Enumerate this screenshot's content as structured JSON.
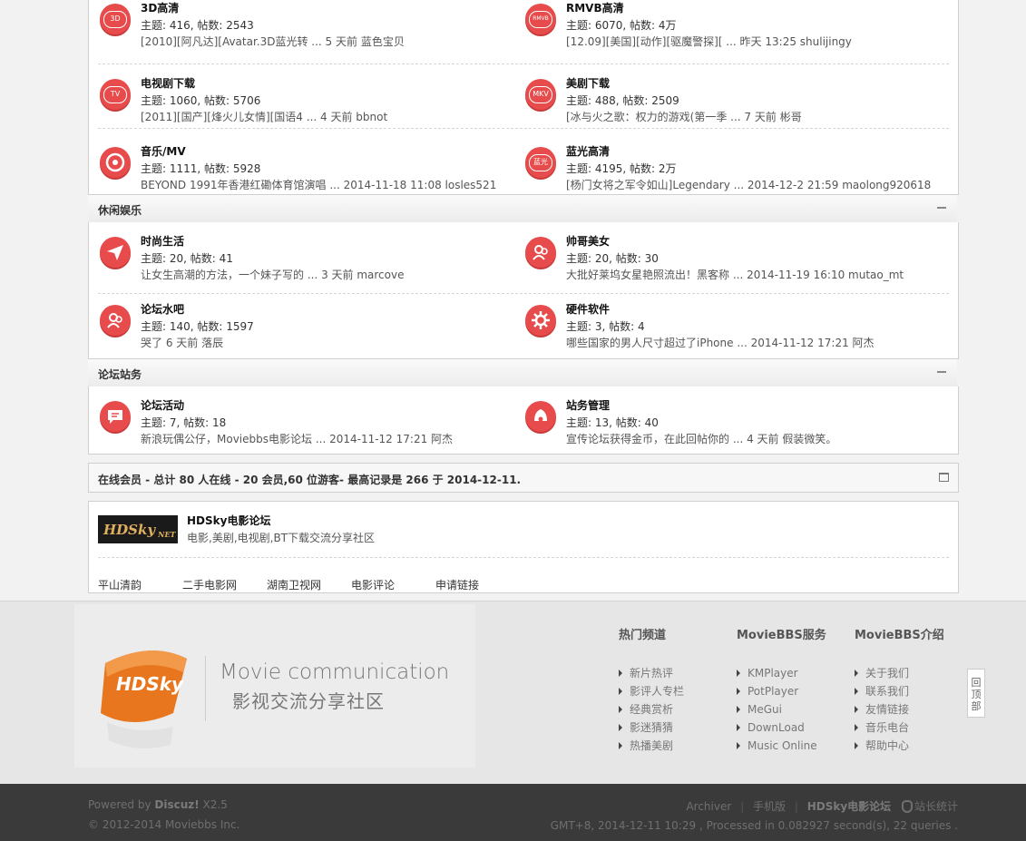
{
  "top_forums": [
    [
      {
        "name": "3D高清",
        "stats": "主题: 416, 帖数: 2543",
        "last": "[2010][阿凡达][Avatar.3D蓝光转 ... 5 天前 蓝色宝贝",
        "icon": "3d-icon",
        "badge": "3D"
      },
      {
        "name": "RMVB高清",
        "stats": "主题: 6070, 帖数: 4万",
        "last": "[12.09][美国][动作][驱魔警探][ ... 昨天 13:25 shulijingy",
        "icon": "rmvb-icon",
        "badge": "RMVB"
      }
    ],
    [
      {
        "name": "电视剧下载",
        "stats": "主题: 1060, 帖数: 5706",
        "last": "[2011][国产][烽火儿女情][国语4 ... 4 天前 bbnot",
        "icon": "tv-icon",
        "badge": "TV"
      },
      {
        "name": "美剧下载",
        "stats": "主题: 488, 帖数: 2509",
        "last": "[冰与火之歌：权力的游戏(第一季 ... 7 天前 彬哥",
        "icon": "mkv-icon",
        "badge": "MKV"
      }
    ],
    [
      {
        "name": "音乐/MV",
        "stats": "主题: 1111, 帖数: 5928",
        "last": "BEYOND 1991年香港红磡体育馆演唱 ... 2014-11-18 11:08 losles521",
        "icon": "music-disc-icon",
        "badge": ""
      },
      {
        "name": "蓝光高清",
        "stats": "主题: 4195, 帖数: 2万",
        "last": "[杨门女将之军令如山]Legendary ... 2014-12-2 21:59 maolong920618",
        "icon": "bluray-icon",
        "badge": "蓝光"
      }
    ]
  ],
  "cat_leisure": {
    "title": "休闲娱乐"
  },
  "leisure_forums": [
    [
      {
        "name": "时尚生活",
        "stats": "主题: 20, 帖数: 41",
        "last": "让女生高潮的方法，一个妹子写的 ... 3 天前 marcove",
        "icon": "paper-plane-icon",
        "badge": ""
      },
      {
        "name": "帅哥美女",
        "stats": "主题: 20, 帖数: 30",
        "last": "大批好莱坞女星艳照流出！黑客称 ... 2014-11-19 16:10 mutao_mt",
        "icon": "users-icon",
        "badge": ""
      }
    ],
    [
      {
        "name": "论坛水吧",
        "stats": "主题: 140, 帖数: 1597",
        "last": "哭了 6 天前 落辰",
        "icon": "users-icon",
        "badge": ""
      },
      {
        "name": "硬件软件",
        "stats": "主题: 3, 帖数: 4",
        "last": "哪些国家的男人尺寸超过了iPhone ... 2014-11-12 17:21 阿杰",
        "icon": "gear-icon",
        "badge": ""
      }
    ]
  ],
  "cat_admin": {
    "title": "论坛站务"
  },
  "admin_forums": [
    [
      {
        "name": "论坛活动",
        "stats": "主题: 7, 帖数: 18",
        "last": "新浪玩偶公仔，Moviebbs电影论坛 ... 2014-11-12 17:21 阿杰",
        "icon": "chat-icon",
        "badge": ""
      },
      {
        "name": "站务管理",
        "stats": "主题: 13, 帖数: 40",
        "last": "宣传论坛获得金币，在此回帖你的 ... 4 天前 假装微笑。",
        "icon": "bell-icon",
        "badge": ""
      }
    ]
  ],
  "online": {
    "text": "在线会员 - 总计 80 人在线 - 20 会员,60 位游客- 最高记录是 266 于 2014-12-11."
  },
  "friend_link": {
    "logo_text": "HDSky",
    "title": "HDSky电影论坛",
    "desc": "电影,美剧,电视剧,BT下载交流分享社区",
    "links": [
      "平山清韵",
      "二手电影网",
      "湖南卫视网",
      "电影评论",
      "申请链接"
    ]
  },
  "footer": {
    "brand_logo": "HDSky",
    "slogan_en": "Movie communication",
    "slogan_cn": "影视交流分享社区",
    "columns": [
      {
        "heading": "热门频道",
        "items": [
          "新片热评",
          "影评人专栏",
          "经典赏析",
          "影迷猜猜",
          "热播美剧"
        ]
      },
      {
        "heading": "MovieBBS服务",
        "items": [
          "KMPlayer",
          "PotPlayer",
          "MeGui",
          "DownLoad",
          "Music Online"
        ]
      },
      {
        "heading": "MovieBBS介绍",
        "items": [
          "关于我们",
          "联系我们",
          "友情链接",
          "音乐电台",
          "帮助中心"
        ]
      }
    ],
    "to_top": "回顶部"
  },
  "bottom": {
    "powered_prefix": "Powered by ",
    "powered_brand": "Discuz!",
    "powered_version": " X2.5",
    "copyright": "© 2012-2014 Moviebbs Inc.",
    "nav": [
      "Archiver",
      "手机版",
      "HDSky电影论坛",
      "站长统计"
    ],
    "stats": "GMT+8, 2014-12-11 10:29 , Processed in 0.082927 second(s), 22 queries ."
  },
  "colors": {
    "accent_red": "#e84b4b",
    "orange": "#e8761e"
  }
}
